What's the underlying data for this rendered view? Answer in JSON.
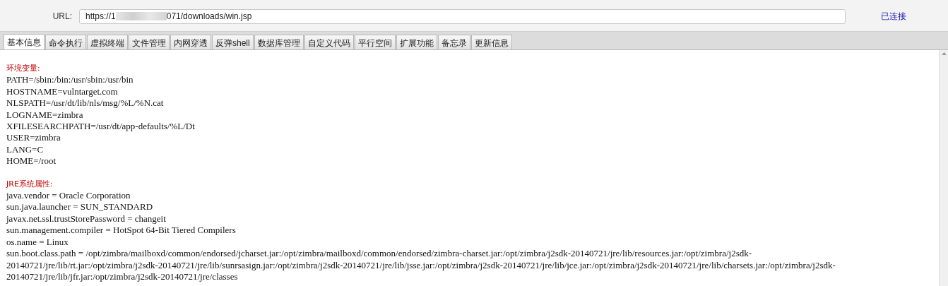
{
  "url_bar": {
    "label": "URL:",
    "value_start": "https://1",
    "value_end": "071/downloads/win.jsp",
    "status": "已连接"
  },
  "tabs": [
    {
      "label": "基本信息",
      "selected": true
    },
    {
      "label": "命令执行",
      "selected": false
    },
    {
      "label": "虚拟终端",
      "selected": false
    },
    {
      "label": "文件管理",
      "selected": false
    },
    {
      "label": "内网穿透",
      "selected": false
    },
    {
      "label": "反弹shell",
      "selected": false
    },
    {
      "label": "数据库管理",
      "selected": false
    },
    {
      "label": "自定义代码",
      "selected": false
    },
    {
      "label": "平行空间",
      "selected": false
    },
    {
      "label": "扩展功能",
      "selected": false
    },
    {
      "label": "备忘录",
      "selected": false
    },
    {
      "label": "更新信息",
      "selected": false
    }
  ],
  "sections": [
    {
      "heading": "环境变量:",
      "lines": [
        "PATH=/sbin:/bin:/usr/sbin:/usr/bin",
        "HOSTNAME=vulntarget.com",
        "NLSPATH=/usr/dt/lib/nls/msg/%L/%N.cat",
        "LOGNAME=zimbra",
        "XFILESEARCHPATH=/usr/dt/app-defaults/%L/Dt",
        "USER=zimbra",
        "LANG=C",
        "HOME=/root"
      ]
    },
    {
      "heading": "JRE系统属性:",
      "lines": [
        "java.vendor = Oracle Corporation",
        "sun.java.launcher = SUN_STANDARD",
        "javax.net.ssl.trustStorePassword = changeit",
        "sun.management.compiler = HotSpot 64-Bit Tiered Compilers",
        "os.name = Linux",
        "sun.boot.class.path = /opt/zimbra/mailboxd/common/endorsed/jcharset.jar:/opt/zimbra/mailboxd/common/endorsed/zimbra-charset.jar:/opt/zimbra/j2sdk-20140721/jre/lib/resources.jar:/opt/zimbra/j2sdk-20140721/jre/lib/rt.jar:/opt/zimbra/j2sdk-20140721/jre/lib/sunrsasign.jar:/opt/zimbra/j2sdk-20140721/jre/lib/jsse.jar:/opt/zimbra/j2sdk-20140721/jre/lib/jce.jar:/opt/zimbra/j2sdk-20140721/jre/lib/charsets.jar:/opt/zimbra/j2sdk-20140721/jre/lib/jfr.jar:/opt/zimbra/j2sdk-20140721/jre/classes"
      ]
    }
  ]
}
